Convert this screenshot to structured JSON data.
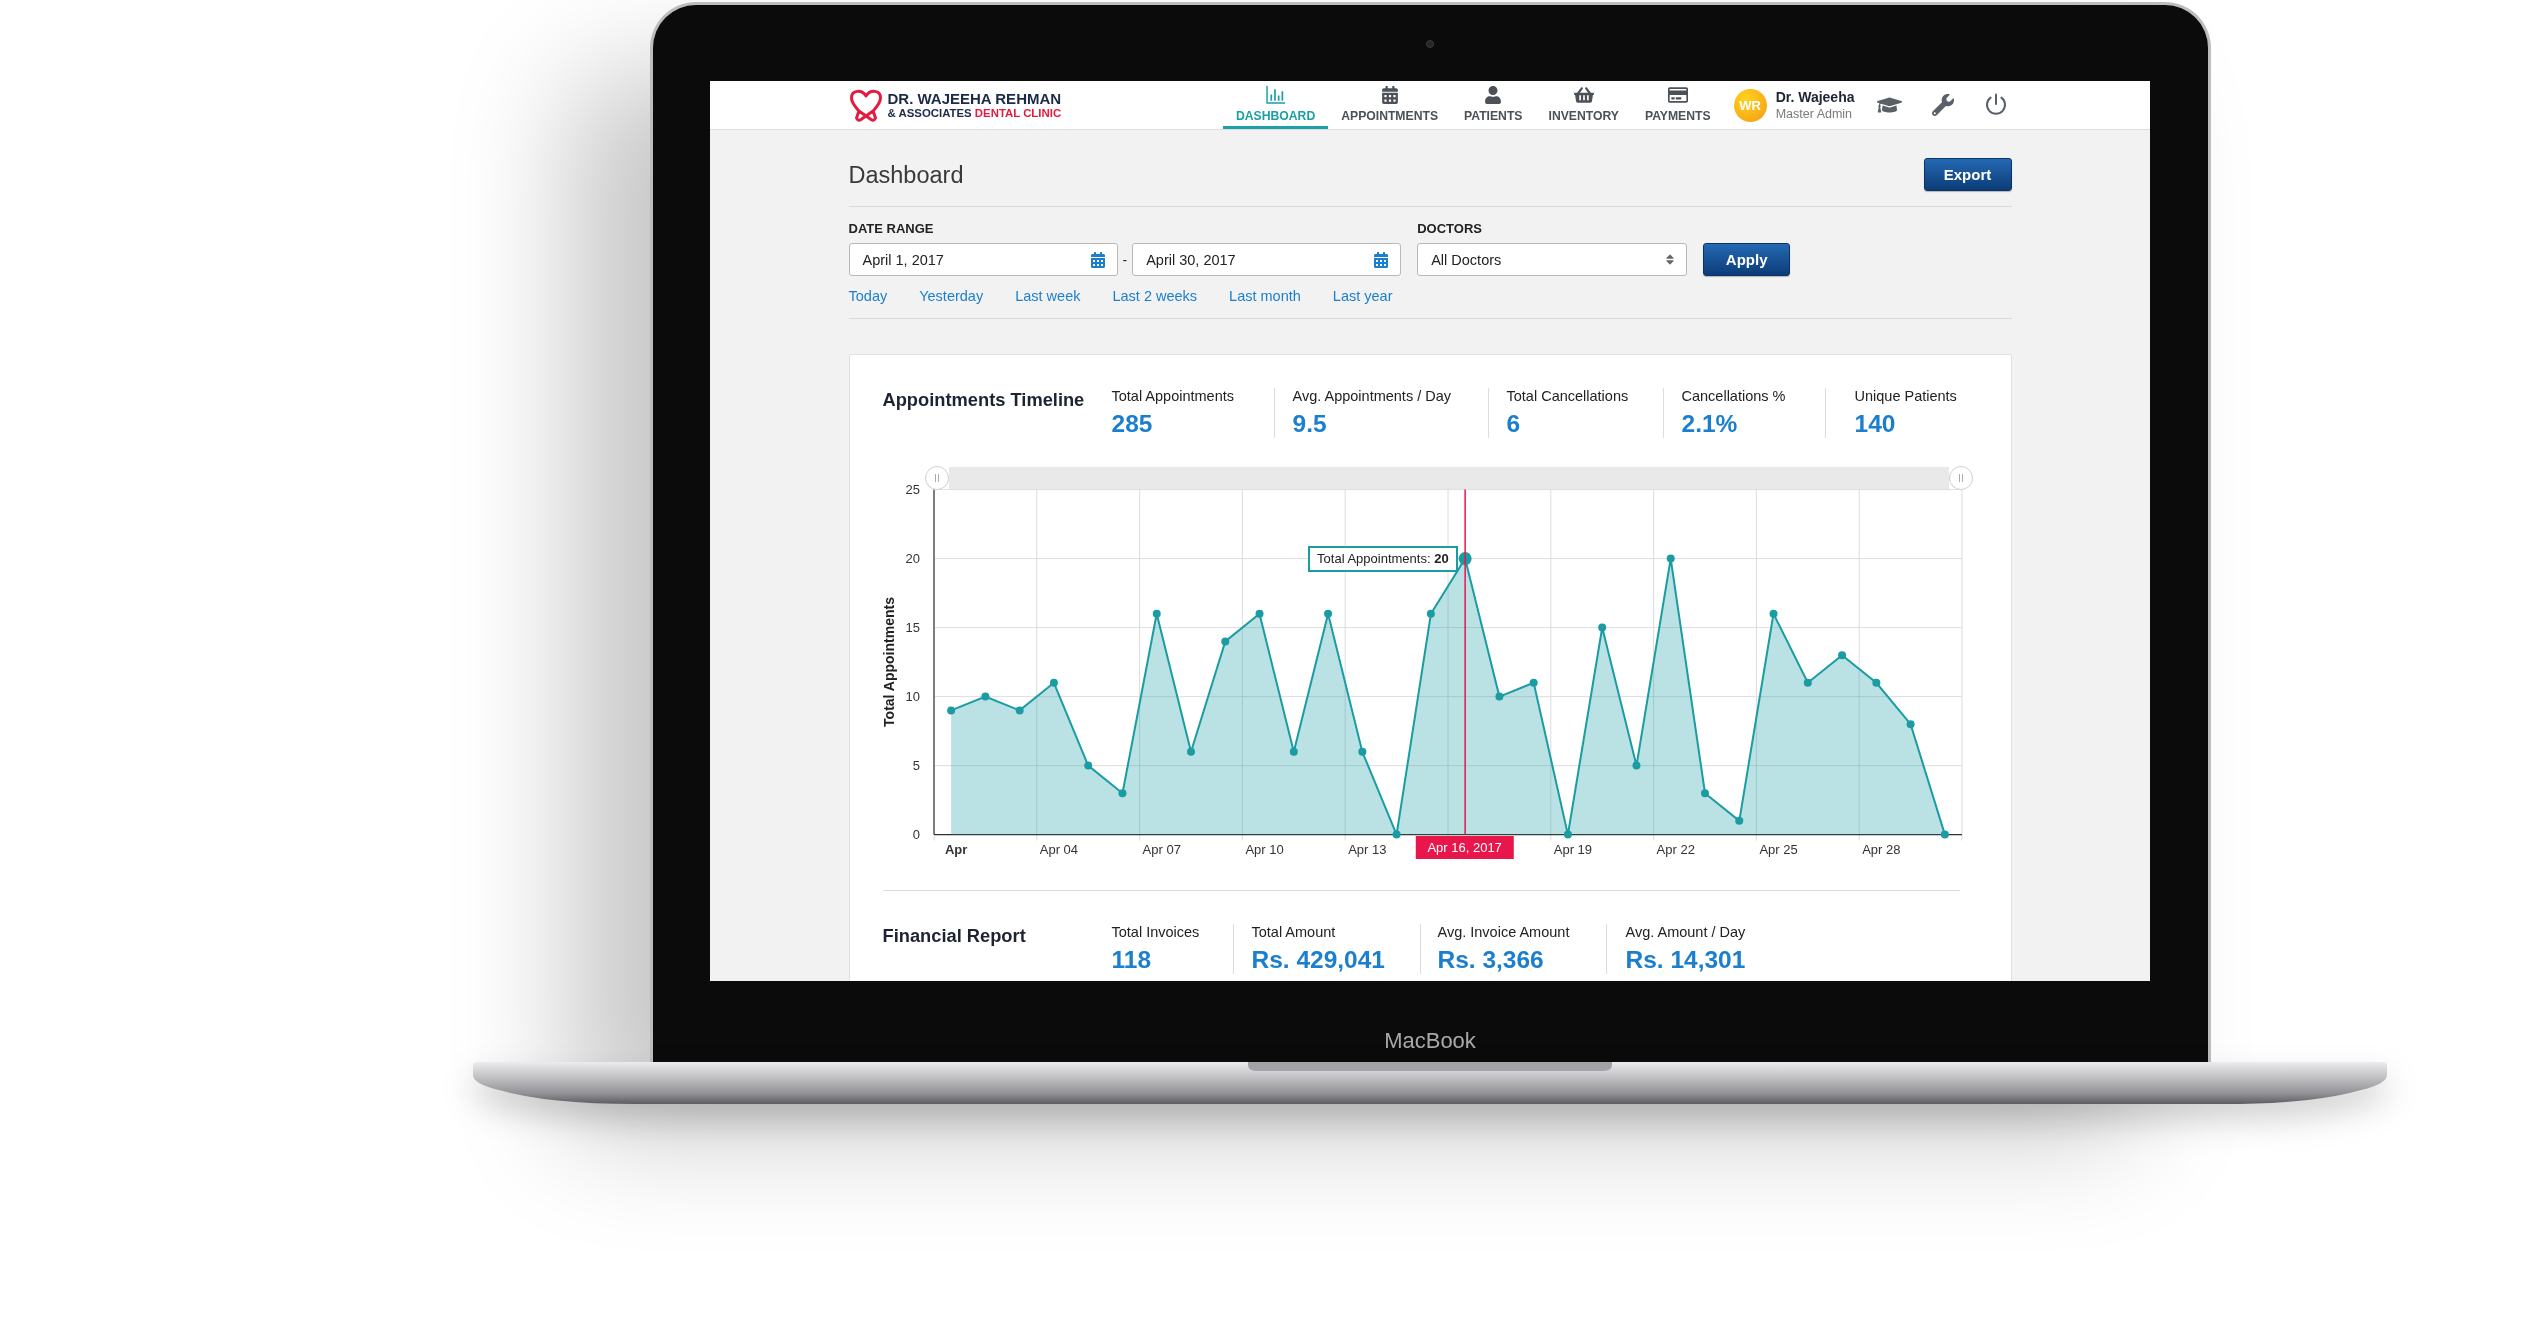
{
  "device": {
    "label": "MacBook"
  },
  "header": {
    "logo": {
      "name": "DR. WAJEEHA REHMAN",
      "subtitle": "& ASSOCIATES",
      "subtitle_accent": "DENTAL CLINIC"
    },
    "nav": [
      {
        "label": "DASHBOARD",
        "selected": true
      },
      {
        "label": "APPOINTMENTS",
        "selected": false
      },
      {
        "label": "PATIENTS",
        "selected": false
      },
      {
        "label": "INVENTORY",
        "selected": false
      },
      {
        "label": "PAYMENTS",
        "selected": false
      }
    ],
    "user": {
      "initials": "WR",
      "name": "Dr. Wajeeha",
      "role": "Master Admin"
    }
  },
  "page": {
    "title": "Dashboard",
    "export_button": "Export"
  },
  "filters": {
    "date_range": {
      "label": "DATE RANGE",
      "from": "April 1, 2017",
      "separator": "-",
      "to": "April 30, 2017"
    },
    "doctors": {
      "label": "DOCTORS",
      "value": "All Doctors"
    },
    "apply_button": "Apply",
    "quick_ranges": [
      "Today",
      "Yesterday",
      "Last week",
      "Last 2 weeks",
      "Last month",
      "Last year"
    ]
  },
  "appointments": {
    "title": "Appointments Timeline",
    "stats": [
      {
        "label": "Total Appointments",
        "value": "285"
      },
      {
        "label": "Avg. Appointments / Day",
        "value": "9.5"
      },
      {
        "label": "Total Cancellations",
        "value": "6"
      },
      {
        "label": "Cancellations %",
        "value": "2.1%"
      },
      {
        "label": "Unique Patients",
        "value": "140"
      }
    ],
    "chart_data": {
      "type": "area",
      "ylabel": "Total Appointments",
      "categories": [
        "Apr",
        null,
        null,
        "Apr 04",
        null,
        null,
        "Apr 07",
        null,
        null,
        "Apr 10",
        null,
        null,
        "Apr 13",
        null,
        null,
        "Apr 16, 2017",
        null,
        null,
        "Apr 19",
        null,
        null,
        "Apr 22",
        null,
        null,
        "Apr 25",
        null,
        null,
        "Apr 28",
        null,
        null
      ],
      "series": [
        {
          "color": "#1a9ca2",
          "values": [
            9,
            10,
            9,
            11,
            5,
            3,
            16,
            6,
            14,
            16,
            6,
            16,
            6,
            0,
            16,
            20,
            10,
            11,
            0,
            15,
            5,
            20,
            3,
            1,
            16,
            11,
            13,
            11,
            8,
            0
          ]
        }
      ],
      "ylim": [
        0,
        25
      ],
      "yticks": [
        0,
        5,
        10,
        15,
        20,
        25
      ],
      "grid": true,
      "annotations": [
        {
          "x": "Apr 16, 2017",
          "y": 20,
          "text": "Total Appointments: **20**"
        }
      ]
    }
  },
  "financial": {
    "title": "Financial Report",
    "stats": [
      {
        "label": "Total Invoices",
        "value": "118"
      },
      {
        "label": "Total Amount",
        "value": "Rs. 429,041"
      },
      {
        "label": "Avg. Invoice Amount",
        "value": "Rs. 3,366"
      },
      {
        "label": "Avg. Amount / Day",
        "value": "Rs. 14,301"
      }
    ]
  }
}
